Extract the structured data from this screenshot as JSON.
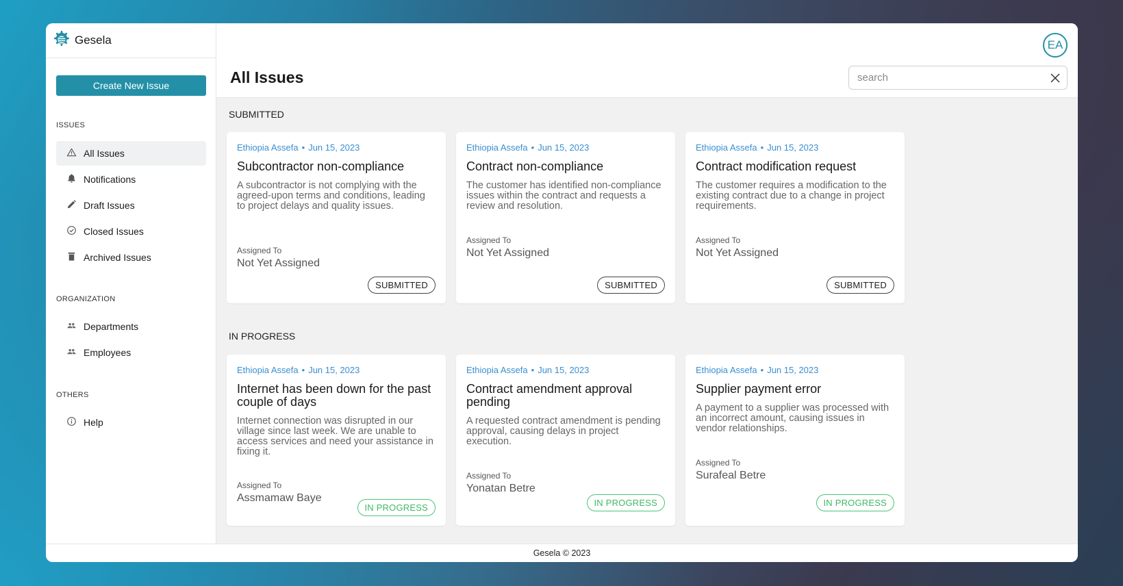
{
  "app": {
    "name": "Gesela",
    "footer": "Gesela © 2023"
  },
  "sidebar": {
    "create_button": "Create New Issue",
    "sections": [
      {
        "label": "ISSUES",
        "items": [
          {
            "label": "All Issues",
            "icon": "warning-triangle-icon",
            "active": true
          },
          {
            "label": "Notifications",
            "icon": "bell-icon",
            "active": false
          },
          {
            "label": "Draft Issues",
            "icon": "pencil-icon",
            "active": false
          },
          {
            "label": "Closed Issues",
            "icon": "check-circle-icon",
            "active": false
          },
          {
            "label": "Archived Issues",
            "icon": "trash-icon",
            "active": false
          }
        ]
      },
      {
        "label": "ORGANIZATION",
        "items": [
          {
            "label": "Departments",
            "icon": "people-icon"
          },
          {
            "label": "Employees",
            "icon": "people-icon"
          }
        ]
      },
      {
        "label": "OTHERS",
        "items": [
          {
            "label": "Help",
            "icon": "info-circle-icon"
          }
        ]
      }
    ]
  },
  "header": {
    "title": "All Issues",
    "avatar_initials": "EA",
    "search": {
      "placeholder": "search",
      "value": ""
    }
  },
  "colors": {
    "accent": "#2490a7",
    "link": "#3a8fd0",
    "in_progress": "#3fb865",
    "submitted": "#222222"
  },
  "groups": [
    {
      "label": "SUBMITTED",
      "cards": [
        {
          "author": "Ethiopia Assefa",
          "date": "Jun 15, 2023",
          "title": "Subcontractor non-compliance",
          "description": "A subcontractor is not complying with the agreed-upon terms and conditions, leading to project delays and quality issues.",
          "assigned_label": "Assigned To",
          "assigned_to": "Not Yet Assigned",
          "status": "SUBMITTED"
        },
        {
          "author": "Ethiopia Assefa",
          "date": "Jun 15, 2023",
          "title": "Contract non-compliance",
          "description": "The customer has identified non-compliance issues within the contract and requests a review and resolution.",
          "assigned_label": "Assigned To",
          "assigned_to": "Not Yet Assigned",
          "status": "SUBMITTED"
        },
        {
          "author": "Ethiopia Assefa",
          "date": "Jun 15, 2023",
          "title": "Contract modification request",
          "description": "The customer requires a modification to the existing contract due to a change in project requirements.",
          "assigned_label": "Assigned To",
          "assigned_to": "Not Yet Assigned",
          "status": "SUBMITTED"
        }
      ]
    },
    {
      "label": "IN PROGRESS",
      "cards": [
        {
          "author": "Ethiopia Assefa",
          "date": "Jun 15, 2023",
          "title": "Internet has been down for the past couple of days",
          "description": "Internet connection was disrupted in our village since last week. We are unable to access services and need your assistance in fixing it.",
          "assigned_label": "Assigned To",
          "assigned_to": "Assmamaw Baye",
          "status": "IN PROGRESS"
        },
        {
          "author": "Ethiopia Assefa",
          "date": "Jun 15, 2023",
          "title": "Contract amendment approval pending",
          "description": "A requested contract amendment is pending approval, causing delays in project execution.",
          "assigned_label": "Assigned To",
          "assigned_to": "Yonatan Betre",
          "status": "IN PROGRESS"
        },
        {
          "author": "Ethiopia Assefa",
          "date": "Jun 15, 2023",
          "title": "Supplier payment error",
          "description": "A payment to a supplier was processed with an incorrect amount, causing issues in vendor relationships.",
          "assigned_label": "Assigned To",
          "assigned_to": "Surafeal Betre",
          "status": "IN PROGRESS"
        }
      ]
    }
  ]
}
